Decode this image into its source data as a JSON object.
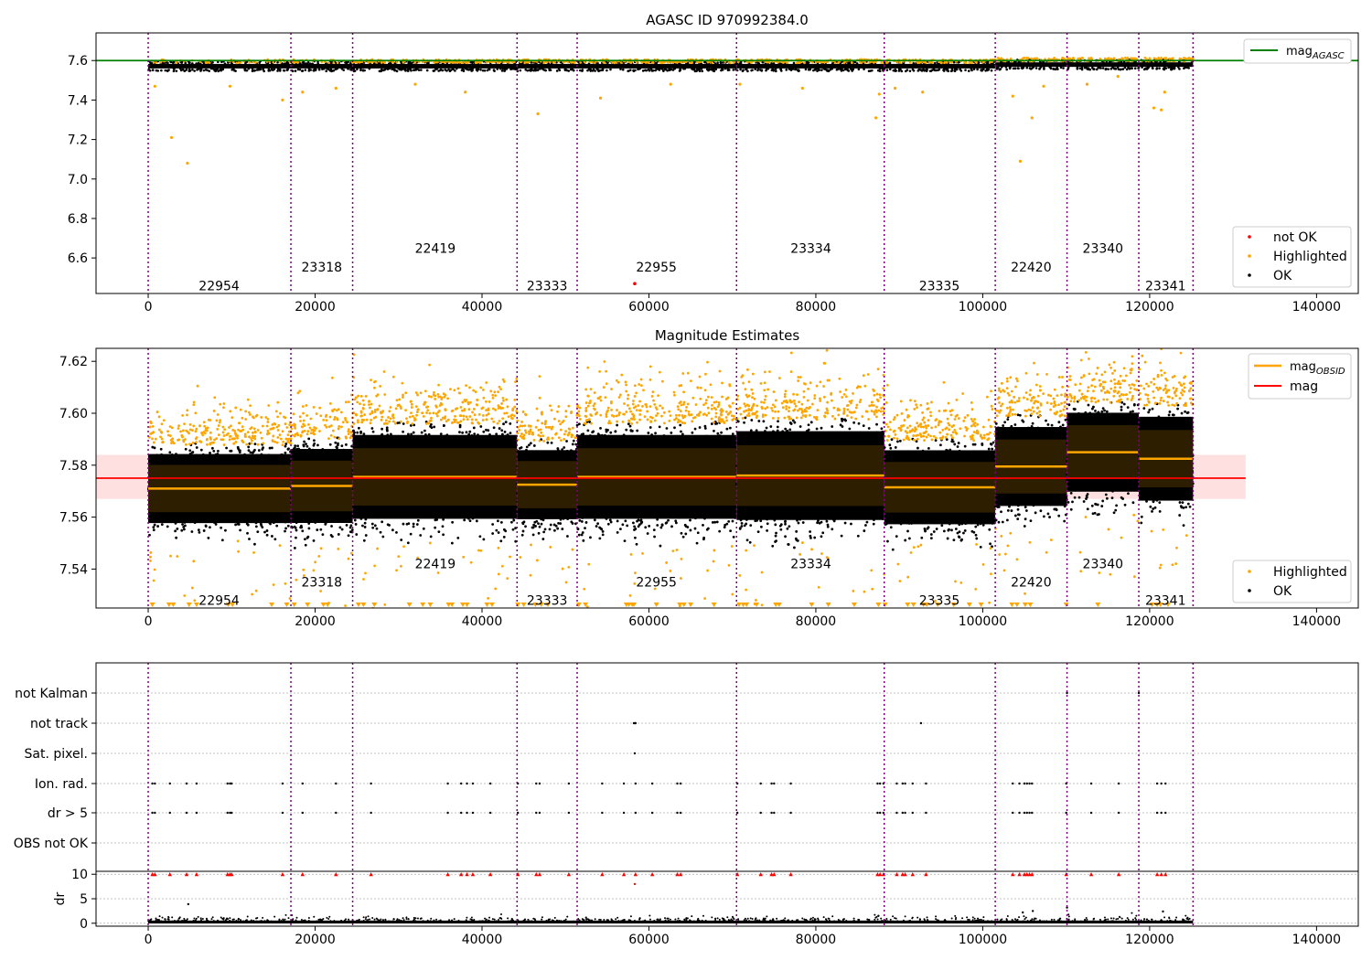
{
  "chart_data": [
    {
      "type": "scatter",
      "title": "AGASC ID 970992384.0",
      "xlim": [
        -6250,
        145000
      ],
      "ylim": [
        6.42,
        7.74
      ],
      "xticks": [
        0,
        20000,
        40000,
        60000,
        80000,
        100000,
        120000,
        140000
      ],
      "yticks": [
        6.6,
        6.8,
        7.0,
        7.2,
        7.4,
        7.6
      ],
      "ytick_labels": [
        "6.6",
        "6.8",
        "7.0",
        "7.2",
        "7.4",
        "7.6"
      ],
      "mag_agasc": 7.6,
      "band_lo": 7.555,
      "band_hi": 7.595,
      "obsid_boundaries": [
        0,
        17100,
        24500,
        44200,
        51400,
        70500,
        88200,
        101500,
        110100,
        118700,
        125200
      ],
      "obsid_labels": [
        {
          "x": 8500,
          "y": 6.46,
          "text": "22954"
        },
        {
          "x": 20800,
          "y": 6.555,
          "text": "23318"
        },
        {
          "x": 34400,
          "y": 6.65,
          "text": "22419"
        },
        {
          "x": 47800,
          "y": 6.46,
          "text": "23333"
        },
        {
          "x": 60900,
          "y": 6.555,
          "text": "22955"
        },
        {
          "x": 79400,
          "y": 6.65,
          "text": "23334"
        },
        {
          "x": 94800,
          "y": 6.46,
          "text": "23335"
        },
        {
          "x": 105800,
          "y": 6.555,
          "text": "22420"
        },
        {
          "x": 114400,
          "y": 6.65,
          "text": "23340"
        },
        {
          "x": 121900,
          "y": 6.46,
          "text": "23341"
        }
      ],
      "highlighted_points": [
        [
          800,
          7.47
        ],
        [
          2800,
          7.21
        ],
        [
          4700,
          7.08
        ],
        [
          9800,
          7.47
        ],
        [
          16100,
          7.4
        ],
        [
          18500,
          7.44
        ],
        [
          22500,
          7.46
        ],
        [
          32000,
          7.48
        ],
        [
          38000,
          7.44
        ],
        [
          46700,
          7.33
        ],
        [
          54200,
          7.41
        ],
        [
          62600,
          7.48
        ],
        [
          70900,
          7.48
        ],
        [
          78400,
          7.46
        ],
        [
          87200,
          7.31
        ],
        [
          87600,
          7.43
        ],
        [
          89500,
          7.46
        ],
        [
          92800,
          7.44
        ],
        [
          103600,
          7.42
        ],
        [
          104500,
          7.09
        ],
        [
          105900,
          7.31
        ],
        [
          107300,
          7.47
        ],
        [
          112500,
          7.48
        ],
        [
          116200,
          7.52
        ],
        [
          120500,
          7.36
        ],
        [
          121400,
          7.35
        ],
        [
          121800,
          7.44
        ]
      ],
      "notok_points": [
        [
          58300,
          6.47
        ]
      ],
      "legends": {
        "upper": [
          "mag_AGASC"
        ],
        "lower": [
          "not OK",
          "Highlighted",
          "OK"
        ]
      }
    },
    {
      "type": "scatter",
      "title": "Magnitude Estimates",
      "xlim": [
        -6250,
        145000
      ],
      "ylim": [
        7.525,
        7.625
      ],
      "xticks": [
        0,
        20000,
        40000,
        60000,
        80000,
        100000,
        120000,
        140000
      ],
      "yticks": [
        7.54,
        7.56,
        7.58,
        7.6,
        7.62
      ],
      "ytick_labels": [
        "7.54",
        "7.56",
        "7.58",
        "7.60",
        "7.62"
      ],
      "mag": 7.575,
      "mag_band": [
        7.567,
        7.584
      ],
      "obsid_segments": [
        {
          "x0": 0,
          "x1": 17100,
          "mean": 7.571,
          "std": 0.007
        },
        {
          "x0": 17100,
          "x1": 24500,
          "mean": 7.572,
          "std": 0.0075
        },
        {
          "x0": 24500,
          "x1": 44200,
          "mean": 7.5755,
          "std": 0.0085
        },
        {
          "x0": 44200,
          "x1": 51400,
          "mean": 7.5725,
          "std": 0.007
        },
        {
          "x0": 51400,
          "x1": 70500,
          "mean": 7.5755,
          "std": 0.0085
        },
        {
          "x0": 70500,
          "x1": 88200,
          "mean": 7.576,
          "std": 0.009
        },
        {
          "x0": 88200,
          "x1": 101500,
          "mean": 7.5715,
          "std": 0.0075
        },
        {
          "x0": 101500,
          "x1": 110100,
          "mean": 7.5795,
          "std": 0.008
        },
        {
          "x0": 110100,
          "x1": 118700,
          "mean": 7.585,
          "std": 0.008
        },
        {
          "x0": 118700,
          "x1": 125200,
          "mean": 7.5825,
          "std": 0.0085
        }
      ],
      "obsid_labels": [
        {
          "x": 8500,
          "y": 7.528,
          "text": "22954"
        },
        {
          "x": 20800,
          "y": 7.535,
          "text": "23318"
        },
        {
          "x": 34400,
          "y": 7.542,
          "text": "22419"
        },
        {
          "x": 47800,
          "y": 7.528,
          "text": "23333"
        },
        {
          "x": 60900,
          "y": 7.535,
          "text": "22955"
        },
        {
          "x": 79400,
          "y": 7.542,
          "text": "23334"
        },
        {
          "x": 94800,
          "y": 7.528,
          "text": "23335"
        },
        {
          "x": 105800,
          "y": 7.535,
          "text": "22420"
        },
        {
          "x": 114400,
          "y": 7.542,
          "text": "23340"
        },
        {
          "x": 121900,
          "y": 7.528,
          "text": "23341"
        }
      ],
      "low_markers_x": [
        500,
        2500,
        3000,
        4900,
        5800,
        9600,
        10100,
        14800,
        16600,
        17500,
        19100,
        21000,
        21500,
        25200,
        25800,
        27100,
        31300,
        32900,
        33800,
        36000,
        36400,
        37700,
        38200,
        40600,
        41200,
        44300,
        45000,
        46400,
        47100,
        47900,
        51600,
        52400,
        57300,
        57600,
        58000,
        58200,
        60900,
        63700,
        64200,
        65000,
        67800,
        70800,
        71300,
        71700,
        72900,
        75200,
        75600,
        79500,
        81500,
        84600,
        87500,
        88300,
        91000,
        91700,
        92900,
        93300,
        94600,
        96500,
        98400,
        99800,
        103500,
        104100,
        105100,
        105700,
        110000,
        113800,
        120300,
        120900,
        121300,
        122200
      ],
      "legends": {
        "upper": [
          "mag_OBSID",
          "mag"
        ],
        "lower": [
          "Highlighted",
          "OK"
        ]
      }
    },
    {
      "type": "scatter",
      "title": "",
      "xlim": [
        -6250,
        145000
      ],
      "xticks": [
        0,
        20000,
        40000,
        60000,
        80000,
        100000,
        120000,
        140000
      ],
      "categories": [
        "not Kalman",
        "not track",
        "Sat. pixel.",
        "Ion. rad.",
        "dr > 5",
        "OBS not OK"
      ],
      "flag_events": {
        "not Kalman": [
          110100,
          118700
        ],
        "not track": [
          58200,
          58350,
          58400,
          92600
        ],
        "Sat. pixel.": [
          58300
        ],
        "Ion. rad.": [
          500,
          800,
          2600,
          4600,
          5800,
          9500,
          9800,
          10000,
          16100,
          18500,
          22500,
          26700,
          35900,
          37500,
          38200,
          38900,
          41000,
          44300,
          46500,
          46900,
          50400,
          54400,
          57000,
          58400,
          60400,
          63400,
          63800,
          70600,
          73400,
          74700,
          75000,
          77000,
          87400,
          87700,
          88100,
          89700,
          90400,
          90700,
          91600,
          93200,
          103600,
          104400,
          105000,
          105300,
          105600,
          105900,
          110000,
          113000,
          116300,
          120900,
          121400,
          121900
        ],
        "dr > 5": [
          500,
          800,
          2600,
          4600,
          5800,
          9500,
          9800,
          10000,
          16100,
          18500,
          22500,
          26700,
          35900,
          37500,
          38200,
          38900,
          41000,
          44300,
          46500,
          46900,
          50400,
          54400,
          57000,
          58400,
          60400,
          63400,
          63800,
          70600,
          73400,
          74700,
          75000,
          77000,
          87400,
          87700,
          88100,
          89700,
          90400,
          90700,
          91600,
          93200,
          103600,
          104400,
          105000,
          105300,
          105600,
          105900,
          110000,
          113000,
          116300,
          120900,
          121400,
          121900
        ],
        "OBS not OK": []
      },
      "dr_panel": {
        "ylabel": "dr",
        "ylim": [
          -0.6,
          10.6
        ],
        "yticks": [
          0,
          5,
          10
        ],
        "high_x": [
          500,
          800,
          2600,
          4600,
          5800,
          9500,
          9800,
          10000,
          16100,
          18500,
          22500,
          26700,
          35900,
          37500,
          38200,
          38900,
          41000,
          44300,
          46500,
          46900,
          50400,
          54400,
          57000,
          58400,
          60400,
          63400,
          63800,
          70600,
          73400,
          74700,
          75000,
          77000,
          87400,
          87700,
          88100,
          89700,
          90400,
          90700,
          91600,
          93200,
          103600,
          104400,
          105000,
          105300,
          105600,
          105900,
          110000,
          113000,
          116300,
          120900,
          121400,
          121900
        ],
        "extra_points": [
          [
            4800,
            3.9
          ],
          [
            58300,
            8.0
          ],
          [
            87500,
            1.5
          ],
          [
            104800,
            2.2
          ],
          [
            106000,
            2.5
          ],
          [
            110100,
            3.2
          ],
          [
            121600,
            2.4
          ]
        ]
      }
    }
  ]
}
